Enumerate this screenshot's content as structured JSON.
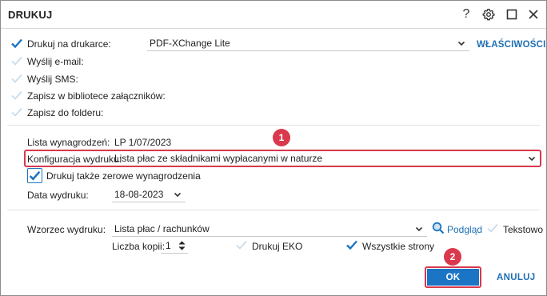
{
  "window": {
    "title": "DRUKUJ",
    "help_glyph": "?",
    "accent": "#1c74c4",
    "highlight": "#d9384d"
  },
  "outputs": {
    "printer": {
      "label": "Drukuj na drukarce:",
      "checked": true,
      "value": "PDF-XChange Lite",
      "props_link": "WŁAŚCIWOŚCI"
    },
    "email": {
      "label": "Wyślij e-mail:",
      "checked": false
    },
    "sms": {
      "label": "Wyślij SMS:",
      "checked": false
    },
    "attachments": {
      "label": "Zapisz w bibliotece załączników:",
      "checked": false
    },
    "folder": {
      "label": "Zapisz do folderu:",
      "checked": false
    }
  },
  "form": {
    "payroll_list_label": "Lista wynagrodzeń:",
    "payroll_list_value": "LP 1/07/2023",
    "config_label": "Konfiguracja wydruku:",
    "config_value": "Lista płac ze składnikami wypłacanymi w naturze",
    "zero_salaries_label": "Drukuj także zerowe wynagrodzenia",
    "zero_salaries_checked": true,
    "print_date_label": "Data wydruku:",
    "print_date_value": "18-08-2023",
    "template_label": "Wzorzec wydruku:",
    "template_value": "Lista płac / rachunków",
    "preview_link": "Podgląd",
    "text_label": "Tekstowo",
    "text_checked": false,
    "copies_label": "Liczba kopii:",
    "copies_value": "1",
    "eko_label": "Drukuj EKO",
    "eko_checked": false,
    "all_pages_label": "Wszystkie strony",
    "all_pages_checked": true
  },
  "annotations": {
    "marker1": "1",
    "marker2": "2"
  },
  "buttons": {
    "ok": "OK",
    "cancel": "ANULUJ"
  }
}
